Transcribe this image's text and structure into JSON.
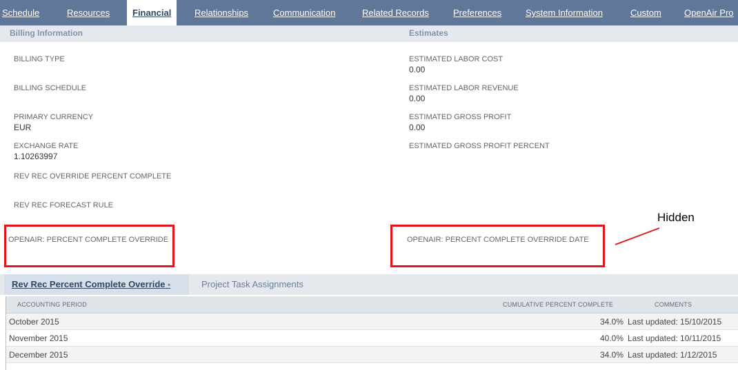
{
  "tabs": [
    {
      "label": "Schedule",
      "active": false
    },
    {
      "label": "Resources",
      "active": false
    },
    {
      "label": "Financial",
      "active": true
    },
    {
      "label": "Relationships",
      "active": false
    },
    {
      "label": "Communication",
      "active": false
    },
    {
      "label": "Related Records",
      "active": false
    },
    {
      "label": "Preferences",
      "active": false
    },
    {
      "label": "System Information",
      "active": false
    },
    {
      "label": "Custom",
      "active": false
    },
    {
      "label": "OpenAir Pro",
      "active": false
    }
  ],
  "billing": {
    "title": "Billing Information",
    "billing_type_label": "BILLING TYPE",
    "billing_schedule_label": "BILLING SCHEDULE",
    "primary_currency_label": "PRIMARY CURRENCY",
    "primary_currency_value": "EUR",
    "exchange_rate_label": "EXCHANGE RATE",
    "exchange_rate_value": "1.10263997",
    "rev_rec_override_label": "REV REC OVERRIDE PERCENT COMPLETE",
    "rev_rec_forecast_label": "REV REC FORECAST RULE",
    "openair_override_label": "OPENAIR: PERCENT COMPLETE OVERRIDE"
  },
  "estimates": {
    "title": "Estimates",
    "labor_cost_label": "ESTIMATED LABOR COST",
    "labor_cost_value": "0.00",
    "labor_revenue_label": "ESTIMATED LABOR REVENUE",
    "labor_revenue_value": "0.00",
    "gross_profit_label": "ESTIMATED GROSS PROFIT",
    "gross_profit_value": "0.00",
    "gross_profit_percent_label": "ESTIMATED GROSS PROFIT PERCENT",
    "openair_override_date_label": "OPENAIR: PERCENT COMPLETE OVERRIDE DATE"
  },
  "annotation": {
    "text": "Hidden",
    "color": "#e0161c"
  },
  "subtabs": {
    "active_label": "Rev Rec Percent Complete Override",
    "active_marker": "•",
    "other_label": "Project Task Assignments"
  },
  "table": {
    "headers": {
      "period": "ACCOUNTING PERIOD",
      "cumulative": "CUMULATIVE PERCENT COMPLETE",
      "comments": "COMMENTS"
    },
    "rows": [
      {
        "period": "October 2015",
        "percent": "34.0%",
        "comment": "Last updated: 15/10/2015"
      },
      {
        "period": "November 2015",
        "percent": "40.0%",
        "comment": "Last updated: 10/11/2015"
      },
      {
        "period": "December 2015",
        "percent": "34.0%",
        "comment": "Last updated: 1/12/2015"
      }
    ]
  },
  "colors": {
    "tabbar": "#607799",
    "section_band": "#e5e9ee",
    "title_blue": "#8093ac",
    "subtab_active": "#32465f"
  }
}
